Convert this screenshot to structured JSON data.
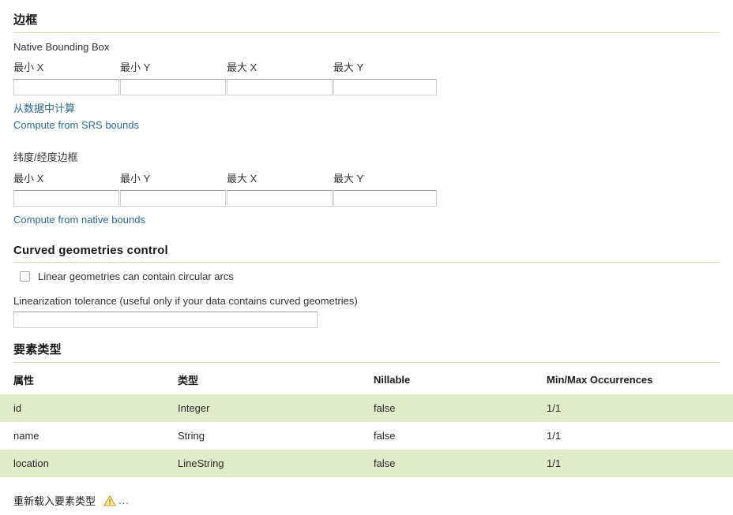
{
  "bounding_box_section": {
    "heading": "边框",
    "native_label": "Native Bounding Box",
    "native_columns": [
      "最小 X",
      "最小 Y",
      "最大 X",
      "最大 Y"
    ],
    "native_values": [
      "",
      "",
      "",
      ""
    ],
    "native_links": [
      "从数据中计算",
      "Compute from SRS bounds"
    ],
    "latlon_label": "纬度/经度边框",
    "latlon_columns": [
      "最小 X",
      "最小 Y",
      "最大 X",
      "最大 Y"
    ],
    "latlon_values": [
      "",
      "",
      "",
      ""
    ],
    "latlon_link": "Compute from native bounds"
  },
  "curved_section": {
    "heading": "Curved geometries control",
    "checkbox_label": "Linear geometries can contain circular arcs",
    "checkbox_checked": false,
    "tolerance_label": "Linearization tolerance (useful only if your data contains curved geometries)",
    "tolerance_value": ""
  },
  "feature_type_section": {
    "heading": "要素类型",
    "columns": [
      "属性",
      "类型",
      "Nillable",
      "Min/Max Occurrences"
    ],
    "rows": [
      {
        "attribute": "id",
        "type": "Integer",
        "nillable": "false",
        "occurrences": "1/1"
      },
      {
        "attribute": "name",
        "type": "String",
        "nillable": "false",
        "occurrences": "1/1"
      },
      {
        "attribute": "location",
        "type": "LineString",
        "nillable": "false",
        "occurrences": "1/1"
      }
    ],
    "reload_label": "重新载入要素类型",
    "reload_icon": "warning-triangle-icon",
    "reload_ellipsis": "..."
  },
  "colors": {
    "heading_rule": "#d3dfab",
    "row_alt": "#dfebc9",
    "link": "#2c6a8f",
    "warning": "#f2c14a"
  }
}
